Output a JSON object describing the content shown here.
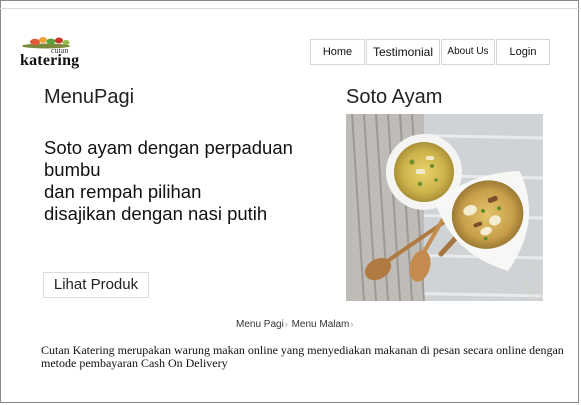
{
  "brand": {
    "top": "cutan",
    "main": "katering"
  },
  "nav": {
    "home": "Home",
    "testimonial": "Testimonial",
    "about": "About Us",
    "login": "Login"
  },
  "hero": {
    "menu_title": "MenuPagi",
    "headline": "Soto ayam dengan perpaduan bumbu\ndan rempah pilihan\ndisajikan dengan nasi putih",
    "button_label": "Lihat Produk",
    "dish_title": "Soto Ayam"
  },
  "tabs": {
    "pagi": "Menu Pagi",
    "malam": "Menu Malam",
    "separator": "›"
  },
  "footer": {
    "description": "Cutan Katering merupakan warung makan online yang menyediakan makanan di pesan secara online dengan metode pembayaran Cash On Delivery"
  },
  "colors": {
    "border": "#d6d6d6",
    "frame": "#8a8a8a"
  }
}
